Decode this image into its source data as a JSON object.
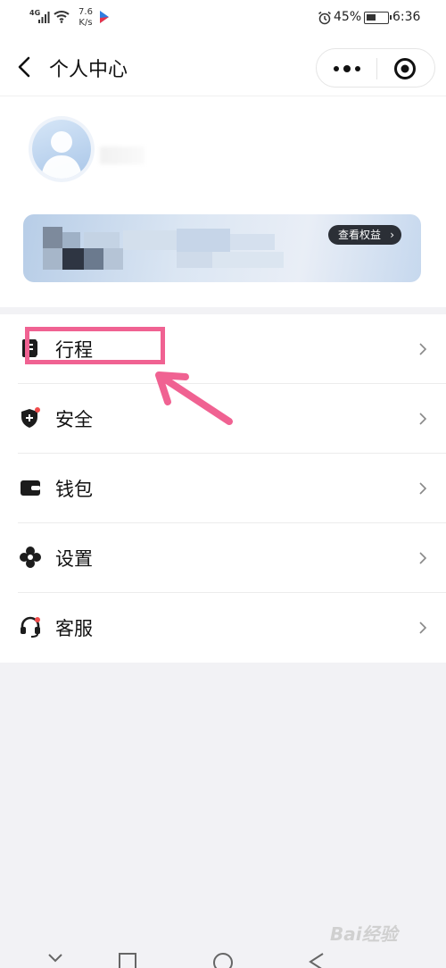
{
  "status_bar": {
    "network": "4G",
    "speed_value": "7.6",
    "speed_unit": "K/s",
    "battery": "45%",
    "battery_level": 0.45,
    "time": "6:36"
  },
  "nav": {
    "title": "个人中心",
    "back_icon": "chevron-left-icon",
    "more_icon": "more-dots-icon",
    "close_icon": "target-close-icon"
  },
  "profile": {
    "rights_button": "查看权益",
    "rights_chevron": "›"
  },
  "menu": {
    "items": [
      {
        "label": "行程",
        "icon": "itinerary-book-icon"
      },
      {
        "label": "安全",
        "icon": "shield-icon"
      },
      {
        "label": "钱包",
        "icon": "wallet-icon"
      },
      {
        "label": "设置",
        "icon": "settings-flower-icon"
      },
      {
        "label": "客服",
        "icon": "headset-icon"
      }
    ]
  },
  "colors": {
    "accent_pink": "#f06292",
    "notice_red": "#f04b4b",
    "text": "#111111",
    "background": "#f2f2f5"
  },
  "watermark": "Bai经验"
}
